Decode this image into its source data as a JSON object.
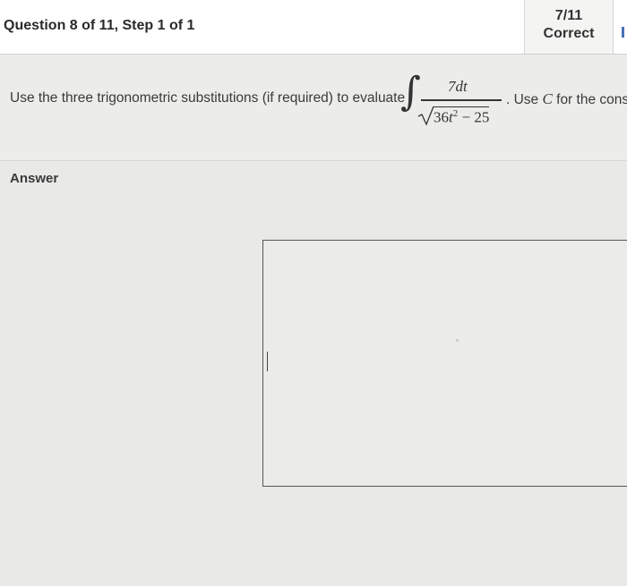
{
  "header": {
    "question_title": "Question 8 of 11, Step 1 of 1",
    "score_fraction": "7/11",
    "score_label": "Correct"
  },
  "question": {
    "prompt_text": "Use the three trigonometric substitutions (if required) to evaluate",
    "integral": {
      "symbol": "∫",
      "numerator": "7dt",
      "denominator_coef": "36",
      "denominator_var": "t",
      "denominator_exp": "2",
      "denominator_rest": " − 25"
    },
    "tail_prefix": ". Use ",
    "tail_var": "C",
    "tail_suffix": " for the cons"
  },
  "answer": {
    "label": "Answer",
    "value": ""
  },
  "colors": {
    "background": "#e9e9e7",
    "header_bg": "#ffffff",
    "edge_mark": "#4a6fb5"
  }
}
